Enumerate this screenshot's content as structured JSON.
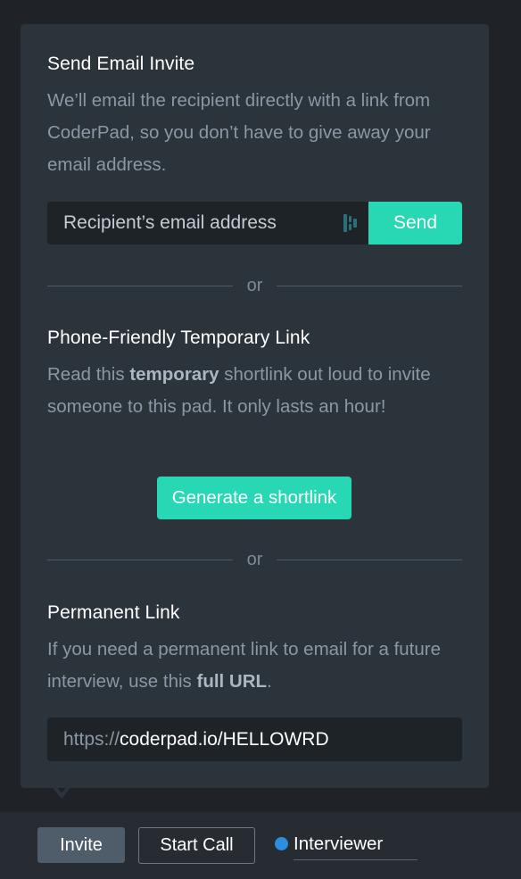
{
  "email_invite": {
    "title": "Send Email Invite",
    "description": "We’ll email the recipient directly with a link from CoderPad, so you don’t have to give away your email address.",
    "input_placeholder": "Recipient’s email address",
    "send_label": "Send"
  },
  "divider_label": "or",
  "shortlink": {
    "title": "Phone-Friendly Temporary Link",
    "desc_pre": "Read this ",
    "desc_bold": "temporary",
    "desc_post": " shortlink out loud to invite someone to this pad. It only lasts an hour!",
    "button_label": "Generate a shortlink"
  },
  "permanent": {
    "title": "Permanent Link",
    "desc_pre": "If you need a permanent link to email for a future interview, use this ",
    "desc_bold": "full URL",
    "desc_post": ".",
    "url_scheme": "https://",
    "url_path": "coderpad.io/HELLOWRD"
  },
  "bottom_bar": {
    "invite_label": "Invite",
    "start_call_label": "Start Call",
    "role_label": "Interviewer"
  },
  "colors": {
    "accent": "#28d7b4",
    "panel": "#2b333b",
    "status_dot": "#2f8de0"
  },
  "icons": {
    "password_manager": "password-manager-icon",
    "popover_arrow": "caret-down-icon"
  }
}
